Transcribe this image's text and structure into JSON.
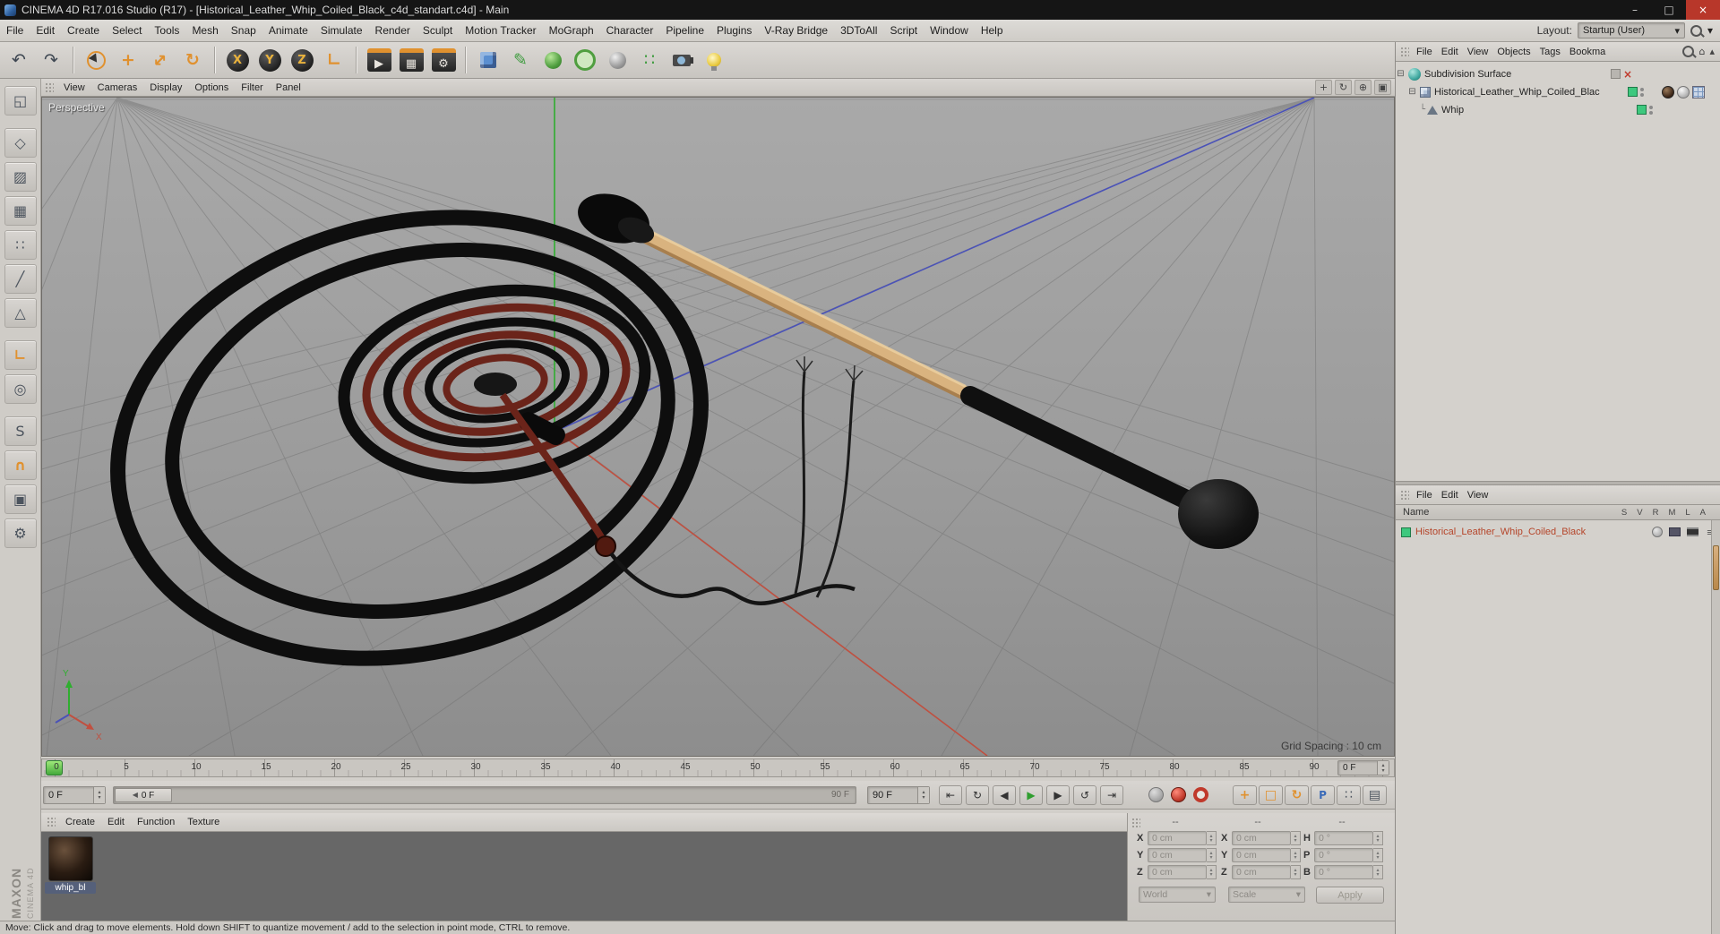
{
  "window": {
    "title": "CINEMA 4D R17.016 Studio (R17) - [Historical_Leather_Whip_Coiled_Black_c4d_standart.c4d] - Main"
  },
  "glyphs": {
    "min": "–",
    "max": "□",
    "close": "×",
    "undo": "↶",
    "redo": "↷",
    "move": "+",
    "scale": "↔",
    "rotate": "↻",
    "coord": "∟",
    "lock_x": "X",
    "lock_y": "Y",
    "lock_z": "Z",
    "render_view": "▶",
    "render_picture": "▦",
    "render_settings": "⚙",
    "pen": "✎",
    "array": "∷",
    "dropdown": "▾",
    "spin_up": "▴",
    "spin_down": "▾",
    "pan": "+",
    "orbit": "↻",
    "zoom": "⊕",
    "toggle_view": "▣",
    "to_start": "⇤",
    "loop": "↻",
    "prev_frame": "◀",
    "play": "▶",
    "next_frame": "▶",
    "play_cycle": "↺",
    "to_end": "⇥",
    "handle_arrow": "◀",
    "toggle_pos": "+",
    "toggle_scale": "□",
    "toggle_rot": "↻",
    "toggle_param": "P",
    "toggle_pla": "∷",
    "toggle_hud": "▤",
    "expander": "⊟",
    "branch": "└",
    "red_x": "×",
    "home": "⌂",
    "up": "▴",
    "list": "≡"
  },
  "menubar": {
    "items": [
      "File",
      "Edit",
      "Create",
      "Select",
      "Tools",
      "Mesh",
      "Snap",
      "Animate",
      "Simulate",
      "Render",
      "Sculpt",
      "Motion Tracker",
      "MoGraph",
      "Character",
      "Pipeline",
      "Plugins",
      "V-Ray Bridge",
      "3DToAll",
      "Script",
      "Window",
      "Help"
    ],
    "layout_label": "Layout:",
    "layout_value": "Startup (User)"
  },
  "left_tools": {
    "glyphs": [
      "◱",
      "◇",
      "▨",
      "▦",
      "∷",
      "╱",
      "△",
      "∟",
      "◎",
      "S",
      "∩",
      "▣",
      "⚙"
    ]
  },
  "viewport": {
    "label": "Perspective",
    "menus": [
      "View",
      "Cameras",
      "Display",
      "Options",
      "Filter",
      "Panel"
    ],
    "grid_spacing": "Grid Spacing : 10 cm",
    "axes": {
      "x": "X",
      "y": "Y"
    }
  },
  "timeline": {
    "ticks": [
      "0",
      "5",
      "10",
      "15",
      "20",
      "25",
      "30",
      "35",
      "40",
      "45",
      "50",
      "55",
      "60",
      "65",
      "70",
      "75",
      "80",
      "85",
      "90"
    ],
    "frame_box": "0 F",
    "start_field": "0 F",
    "handle_label": "0 F",
    "range_end": "90 F",
    "end_field": "90 F"
  },
  "materials_panel": {
    "menus": [
      "Create",
      "Edit",
      "Function",
      "Texture"
    ],
    "material_name": "whip_bl"
  },
  "coordinates": {
    "headers": [
      "--",
      "--",
      "--"
    ],
    "labels": [
      "X",
      "Y",
      "Z",
      "X",
      "Y",
      "Z",
      "H",
      "P",
      "B"
    ],
    "values": [
      "0 cm",
      "0 cm",
      "0 cm",
      "0 cm",
      "0 cm",
      "0 cm",
      "0 °",
      "0 °",
      "0 °"
    ],
    "world": "World",
    "scale": "Scale",
    "apply": "Apply"
  },
  "object_manager": {
    "menus": [
      "File",
      "Edit",
      "View",
      "Objects",
      "Tags",
      "Bookma"
    ],
    "items": [
      {
        "label": "Subdivision Surface"
      },
      {
        "label": "Historical_Leather_Whip_Coiled_Blac"
      },
      {
        "label": "Whip"
      }
    ]
  },
  "material_list": {
    "menus": [
      "File",
      "Edit",
      "View"
    ],
    "name_header": "Name",
    "columns": [
      "S",
      "V",
      "R",
      "M",
      "L",
      "A"
    ],
    "items": [
      {
        "label": "Historical_Leather_Whip_Coiled_Black"
      }
    ]
  },
  "status": {
    "text": "Move: Click and drag to move elements. Hold down SHIFT to quantize movement / add to the selection in point mode, CTRL to remove."
  },
  "branding": {
    "line1": "MAXON",
    "line2": "CINEMA 4D"
  },
  "colors": {
    "accent_orange": "#e0912f",
    "axis_green": "#2fae2f",
    "axis_red": "#c05040",
    "axis_blue": "#4a52b8",
    "enabled_green": "#3ec87e",
    "material_name_red": "#b5452a",
    "viewport_gray": "#9c9c9c"
  }
}
